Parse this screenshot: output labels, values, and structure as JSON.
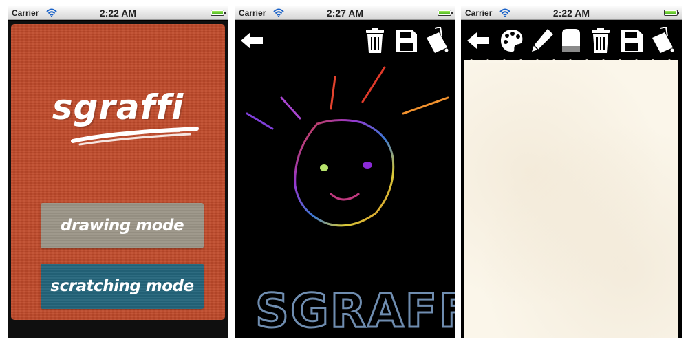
{
  "screens": [
    {
      "status": {
        "carrier": "Carrier",
        "time": "2:22 AM"
      },
      "app": {
        "logo_text": "sgraffi",
        "drawing_mode_label": "drawing mode",
        "scratching_mode_label": "scratching mode"
      },
      "colors": {
        "card": "#c04a2a",
        "drawing_button": "#9a9486",
        "scratching_button": "#23647a"
      }
    },
    {
      "status": {
        "carrier": "Carrier",
        "time": "2:27 AM"
      },
      "toolbar": [
        "back-arrow-icon",
        "trash-icon",
        "save-icon",
        "bucket-icon"
      ],
      "canvas_text": "SGRAFFI"
    },
    {
      "status": {
        "carrier": "Carrier",
        "time": "2:22 AM"
      },
      "toolbar": [
        "back-arrow-icon",
        "palette-icon",
        "pencil-icon",
        "eraser-icon",
        "trash-icon",
        "save-icon",
        "bucket-icon"
      ],
      "colors": {
        "paper": "#fbf6ea"
      }
    }
  ]
}
